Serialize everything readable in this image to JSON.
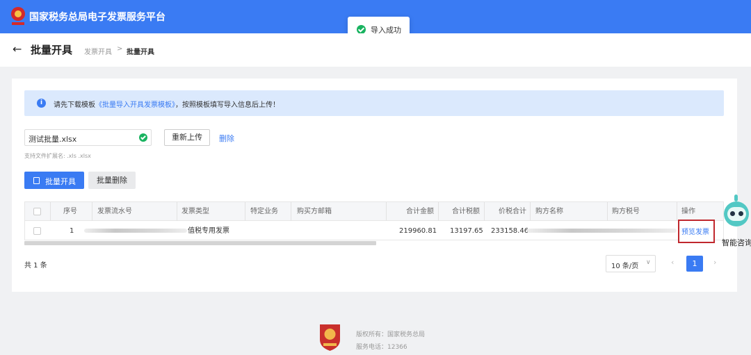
{
  "header": {
    "brand": "国家税务总局电子发票服务平台"
  },
  "toast": {
    "text": "导入成功"
  },
  "subheader": {
    "back": "←",
    "title": "批量开具",
    "breadcrumb": [
      "发票开具",
      "批量开具"
    ],
    "separator": ">"
  },
  "notice": {
    "prefix": "请先下载模板",
    "link": "《批量导入开具发票模板》",
    "suffix": "，按照模板填写导入信息后上传！"
  },
  "upload": {
    "filename": "测试批量.xlsx",
    "reupload_label": "重新上传",
    "delete_label": "删除",
    "hint": "支持文件扩展名: .xls .xlsx"
  },
  "toolbar": {
    "batch_issue_label": "批量开具",
    "batch_delete_label": "批量删除"
  },
  "table": {
    "headers": [
      "序号",
      "发票流水号",
      "发票类型",
      "特定业务",
      "购买方邮箱",
      "合计金额",
      "合计税额",
      "价税合计",
      "购方名称",
      "购方税号",
      "操作"
    ],
    "rows": [
      {
        "index": "1",
        "invoice_type": "值税专用发票",
        "amount": "219960.81",
        "tax": "13197.65",
        "total": "233158.46",
        "action": "预览发票"
      }
    ]
  },
  "pagination": {
    "total": "共 1 条",
    "page_size": "10 条/页",
    "current": "1",
    "prev": "‹",
    "next": "›"
  },
  "assistant": {
    "label": "智能咨询"
  },
  "footer": {
    "copyright": "版权所有：国家税务总局",
    "phone": "服务电话：12366"
  },
  "colors": {
    "primary": "#3a7bf3",
    "success": "#19b360",
    "highlight": "#c0272d"
  }
}
